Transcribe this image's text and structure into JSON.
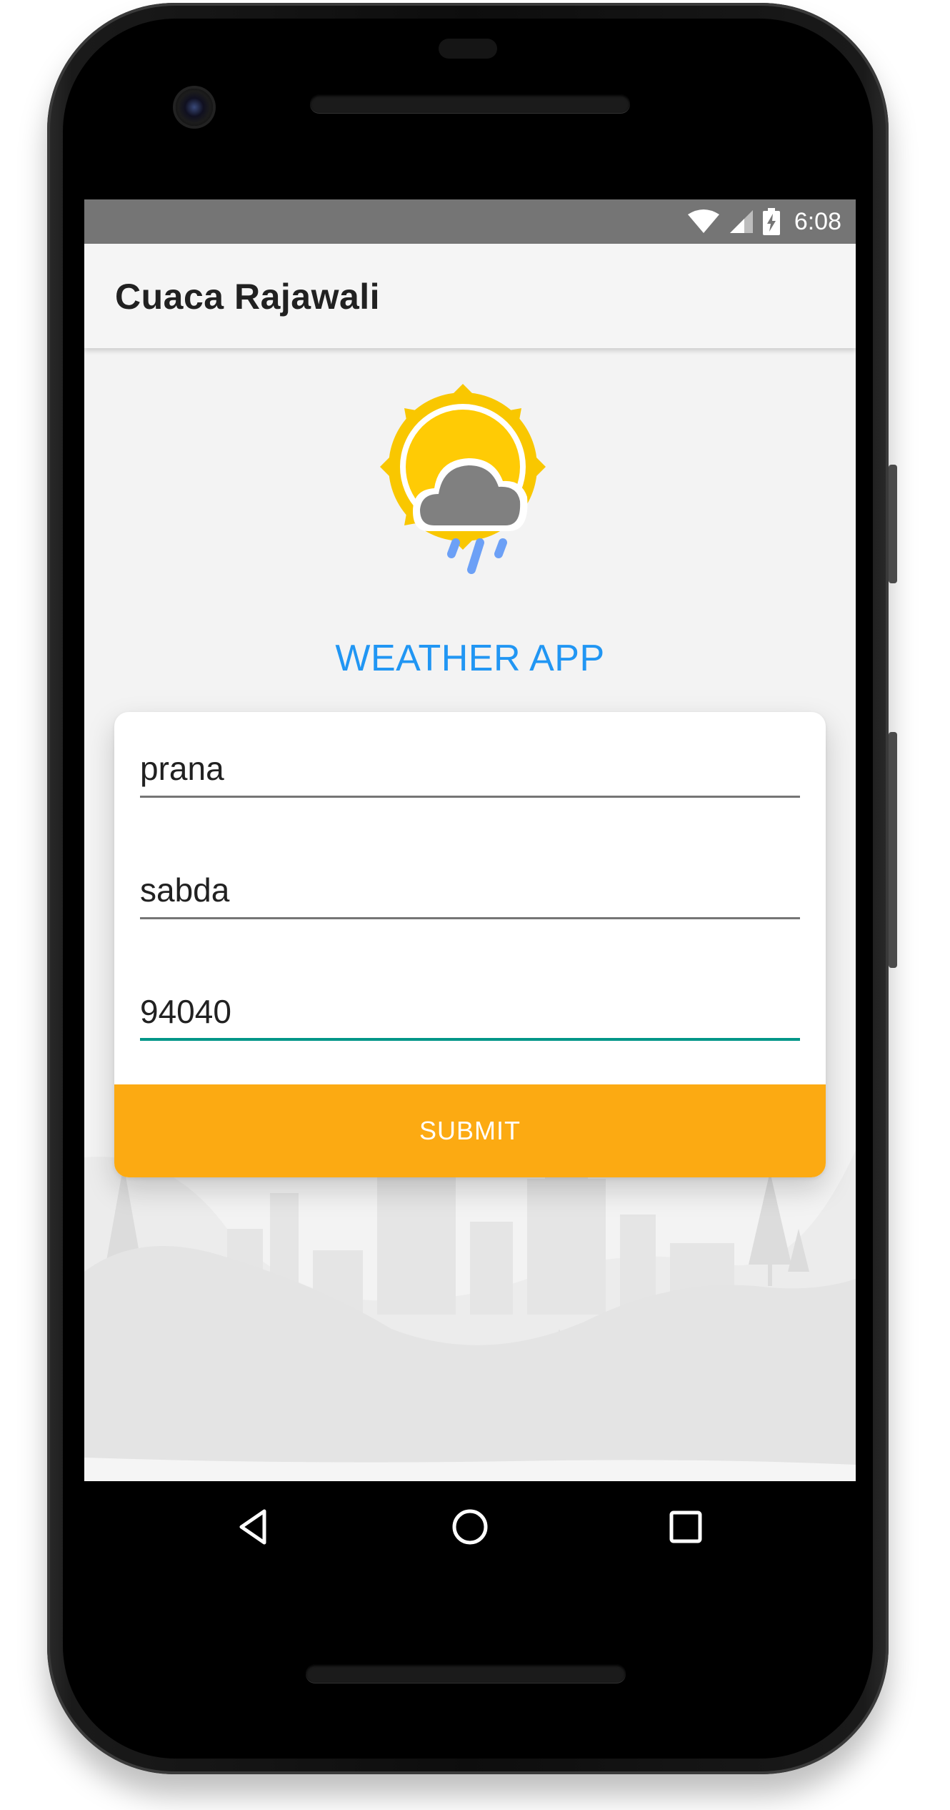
{
  "status_bar": {
    "time": "6:08",
    "icons": [
      "wifi-icon",
      "signal-icon",
      "battery-charging-icon"
    ]
  },
  "app_bar": {
    "title": "Cuaca Rajawali"
  },
  "main": {
    "logo_icon": "sun-cloud-rain-icon",
    "heading": "WEATHER APP",
    "form": {
      "fields": [
        {
          "value": "prana"
        },
        {
          "value": "sabda"
        },
        {
          "value": "94040"
        }
      ],
      "submit_label": "SUBMIT"
    }
  },
  "nav_bar": {
    "icons": [
      "back-icon",
      "home-icon",
      "recents-icon"
    ]
  },
  "colors": {
    "accent_blue": "#2196f3",
    "submit_orange": "#fcaa12",
    "focus_teal": "#009688",
    "status_bar": "#757575"
  }
}
